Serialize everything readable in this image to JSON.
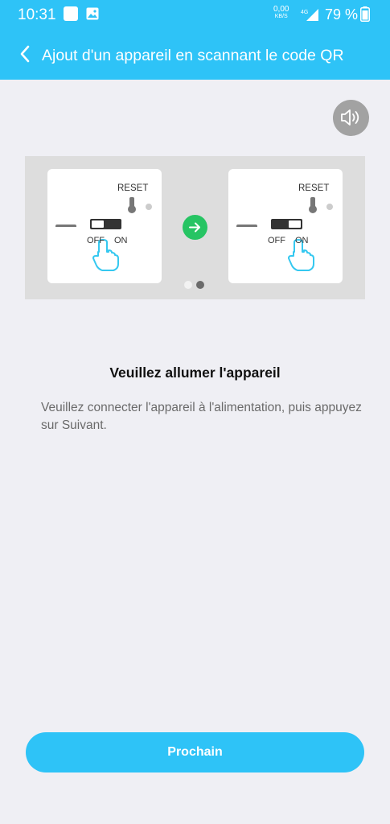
{
  "status_bar": {
    "time": "10:31",
    "net_speed_value": "0,00",
    "net_speed_unit": "KB/S",
    "network_type": "4G",
    "battery": "79 %"
  },
  "header": {
    "title": "Ajout d'un appareil en scannant le code QR"
  },
  "illustration": {
    "reset_label": "RESET",
    "off_label": "OFF",
    "on_label": "ON",
    "page_indicator": {
      "count": 2,
      "active_index": 1
    }
  },
  "content": {
    "heading": "Veuillez allumer l'appareil",
    "description": "Veuillez connecter l'appareil à l'alimentation, puis appuyez sur Suivant."
  },
  "footer": {
    "next_label": "Prochain"
  },
  "colors": {
    "accent": "#2ec3f7",
    "arrow_green": "#26c463",
    "hand_cyan": "#35c8f0"
  },
  "icons": [
    "back-chevron-icon",
    "speaker-icon",
    "arrow-right-icon",
    "hand-pointer-icon",
    "battery-icon",
    "signal-icon",
    "image-icon"
  ]
}
